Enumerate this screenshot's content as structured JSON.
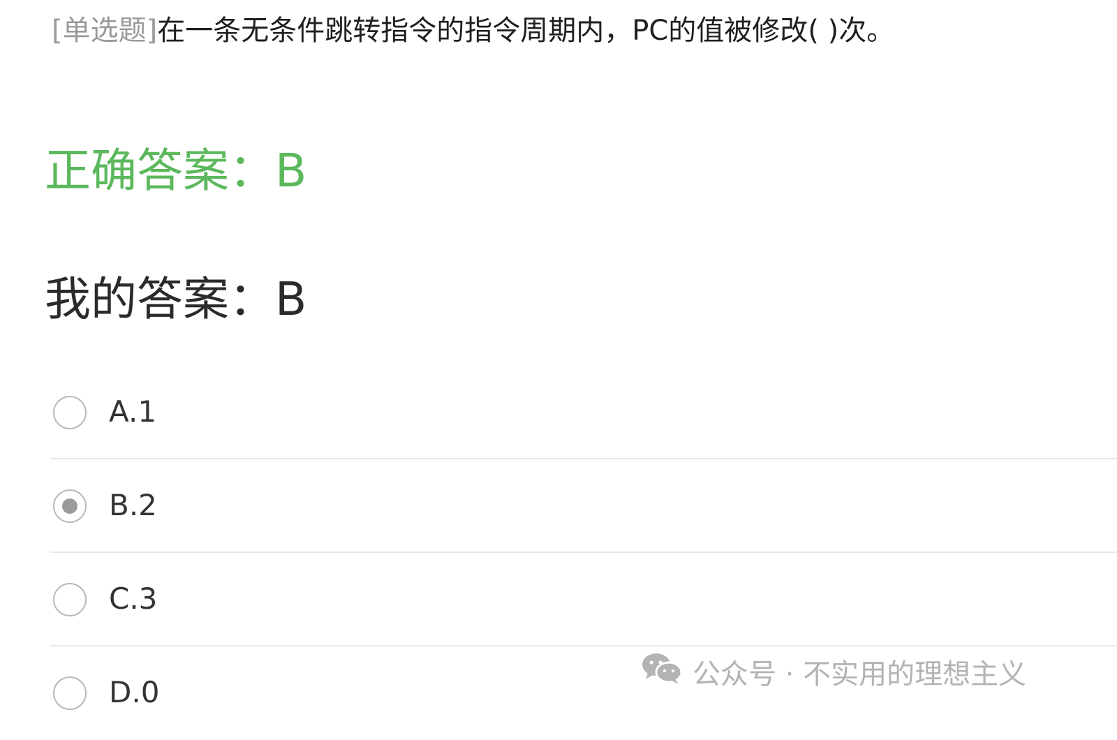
{
  "question": {
    "type_tag": "[单选题]",
    "text": "在一条无条件跳转指令的指令周期内，PC的值被修改( )次。"
  },
  "correct_answer": {
    "label": "正确答案：",
    "value": "B",
    "color": "#5cb85c"
  },
  "my_answer": {
    "label": "我的答案：",
    "value": "B"
  },
  "options": [
    {
      "label": "A.1",
      "selected": false
    },
    {
      "label": "B.2",
      "selected": true
    },
    {
      "label": "C.3",
      "selected": false
    },
    {
      "label": "D.0",
      "selected": false
    }
  ],
  "watermark": {
    "icon": "wechat-icon",
    "text": "公众号 · 不实用的理想主义"
  }
}
